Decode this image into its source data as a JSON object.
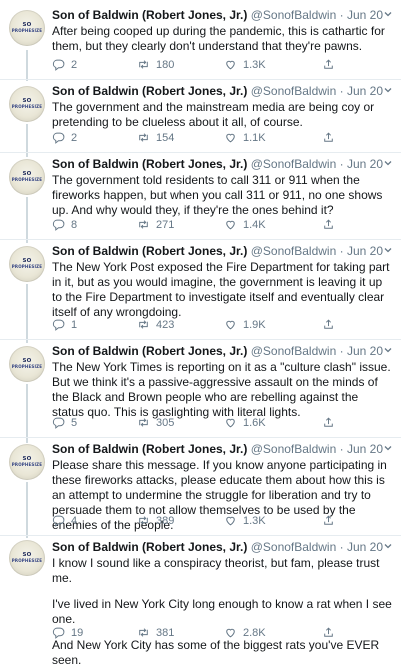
{
  "tweets": [
    {
      "name": "Son of Baldwin (Robert Jones, Jr.)",
      "handle": "@SonofBaldwin",
      "date": "Jun 20",
      "paras": [
        "After being cooped up during the pandemic, this is cathartic for them, but they clearly don't understand that they're pawns."
      ],
      "replies": "2",
      "retweets": "180",
      "likes": "1.3K"
    },
    {
      "name": "Son of Baldwin (Robert Jones, Jr.)",
      "handle": "@SonofBaldwin",
      "date": "Jun 20",
      "paras": [
        "The government and the mainstream media are being coy or pretending to be clueless about it all, of course."
      ],
      "replies": "2",
      "retweets": "154",
      "likes": "1.1K"
    },
    {
      "name": "Son of Baldwin (Robert Jones, Jr.)",
      "handle": "@SonofBaldwin",
      "date": "Jun 20",
      "paras": [
        "The government told residents to call 311 or 911 when the fireworks happen, but when you call 311 or 911, no one shows up. And why would they, if they're the ones behind it?"
      ],
      "replies": "8",
      "retweets": "271",
      "likes": "1.4K"
    },
    {
      "name": "Son of Baldwin (Robert Jones, Jr.)",
      "handle": "@SonofBaldwin",
      "date": "Jun 20",
      "paras": [
        "The New York Post exposed the Fire Department for taking part in it, but as you would imagine, the government is leaving it up to the Fire Department to investigate itself and eventually clear itself of any wrongdoing."
      ],
      "replies": "1",
      "retweets": "423",
      "likes": "1.9K"
    },
    {
      "name": "Son of Baldwin (Robert Jones, Jr.)",
      "handle": "@SonofBaldwin",
      "date": "Jun 20",
      "paras": [
        "The New York Times is reporting on it as a \"culture clash\" issue. But we think it's a passive-aggressive assault on the minds of the Black and Brown people who are rebelling against the status quo. This is gaslighting with literal lights."
      ],
      "replies": "5",
      "retweets": "305",
      "likes": "1.6K"
    },
    {
      "name": "Son of Baldwin (Robert Jones, Jr.)",
      "handle": "@SonofBaldwin",
      "date": "Jun 20",
      "paras": [
        "Please share this message. If you know anyone participating in these fireworks attacks, please educate them about how this is an attempt to undermine the struggle for liberation and try to persuade them to not allow themselves to be used by the enemies of the people."
      ],
      "replies": "4",
      "retweets": "389",
      "likes": "1.3K"
    },
    {
      "name": "Son of Baldwin (Robert Jones, Jr.)",
      "handle": "@SonofBaldwin",
      "date": "Jun 20",
      "paras": [
        "I know I sound like a conspiracy theorist, but fam, please trust me.",
        "I've lived in New York City long enough to know a rat when I see one.",
        "And New York City has some of the biggest rats you've EVER seen."
      ],
      "replies": "19",
      "retweets": "381",
      "likes": "2.8K"
    }
  ],
  "avatar_text": {
    "line1": "SO",
    "line2": "PROPHESIZE",
    "line3": "BALDWIN"
  },
  "separator": "·"
}
